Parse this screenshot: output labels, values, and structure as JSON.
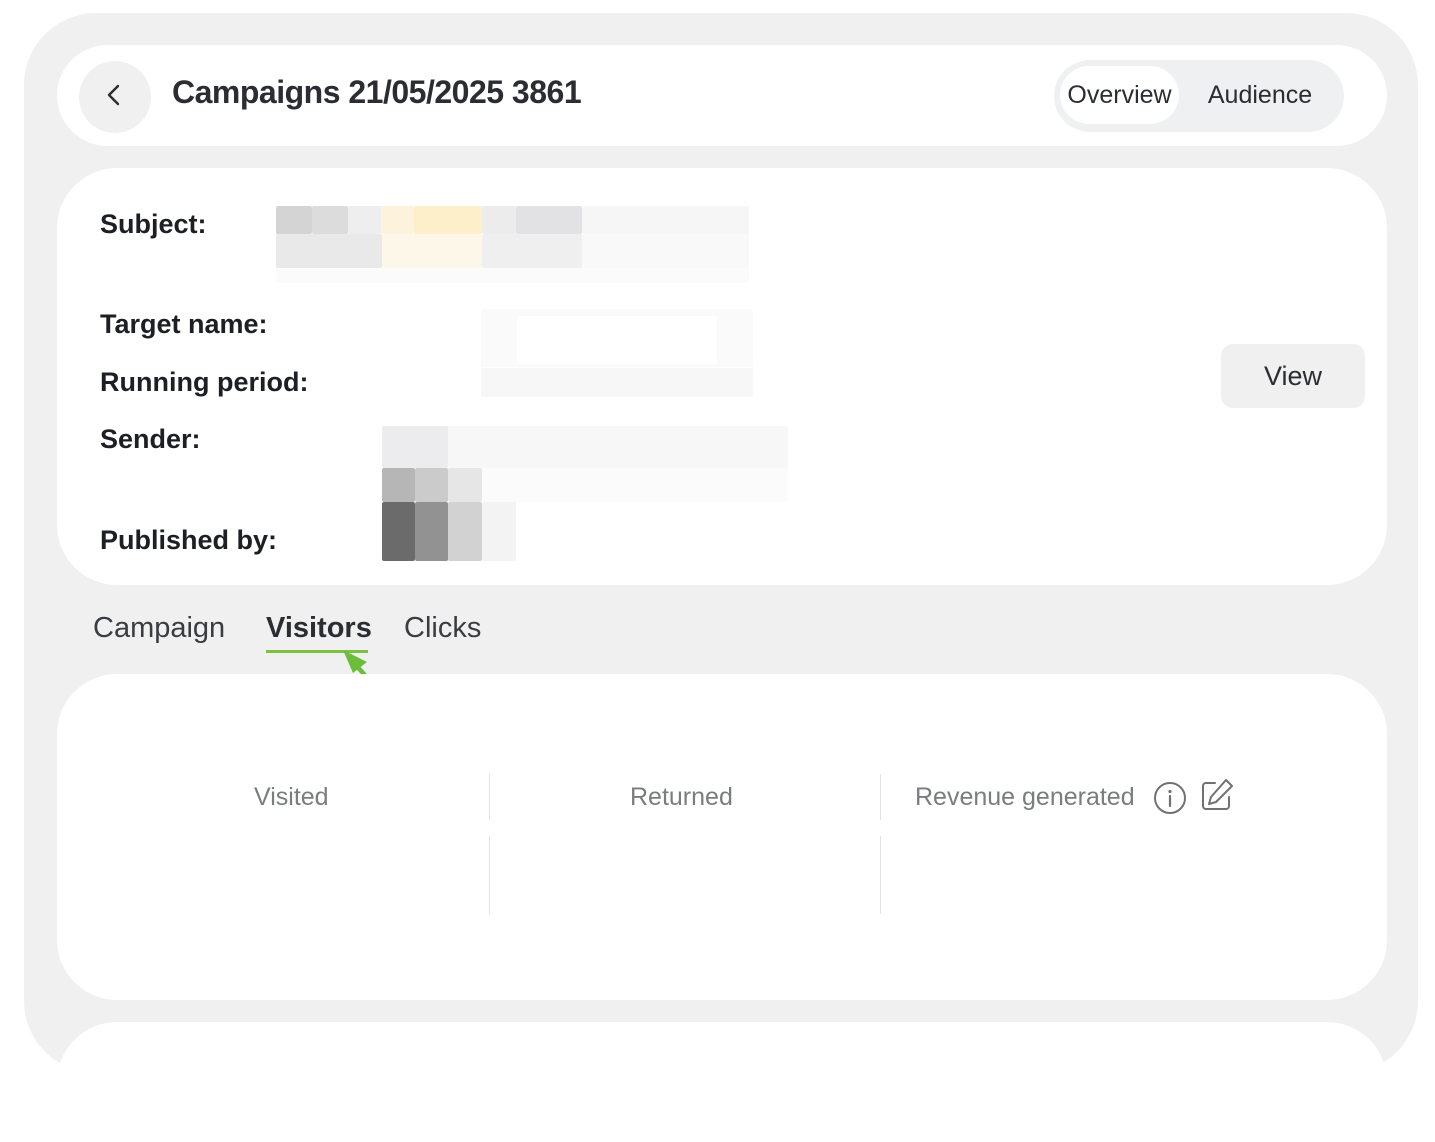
{
  "header": {
    "title": "Campaigns 21/05/2025 3861",
    "tabs": [
      {
        "label": "Overview"
      },
      {
        "label": "Audience"
      }
    ]
  },
  "info": {
    "subject_label": "Subject:",
    "target_name_label": "Target name:",
    "running_period_label": "Running period:",
    "sender_label": "Sender:",
    "published_by_label": "Published by:",
    "view_button": "View"
  },
  "tabs": [
    {
      "label": "Campaign"
    },
    {
      "label": "Visitors"
    },
    {
      "label": "Clicks"
    }
  ],
  "stats": {
    "visited": "Visited",
    "returned": "Returned",
    "revenue": "Revenue generated"
  },
  "colors": {
    "accent": "#7bc043",
    "background": "#f0f0f0"
  },
  "icons": {
    "back": "chevron-left-icon",
    "info": "info-icon",
    "edit": "edit-icon",
    "pointer": "arrow-annotation-icon"
  }
}
